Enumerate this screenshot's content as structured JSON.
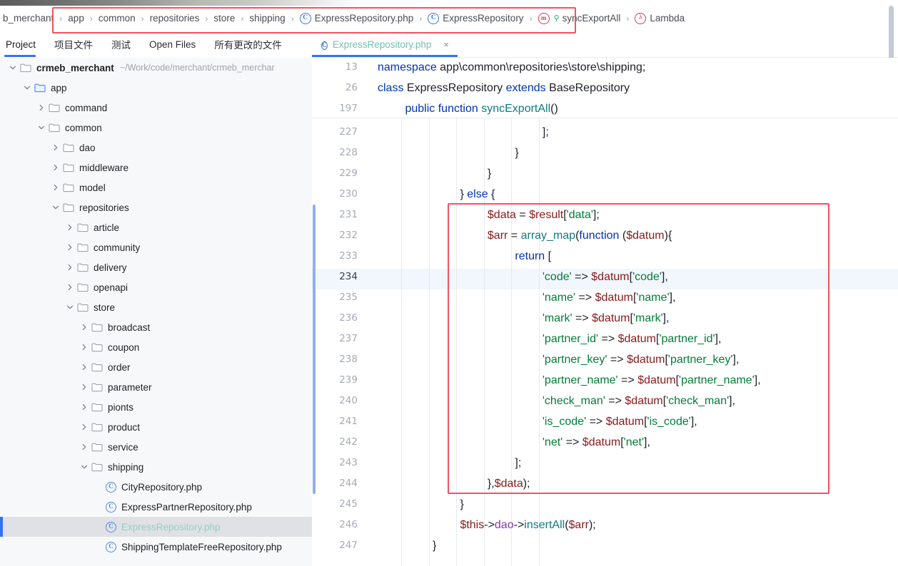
{
  "breadcrumb": {
    "items": [
      {
        "label": "b_merchant",
        "icon": null
      },
      {
        "label": "app",
        "icon": null
      },
      {
        "label": "common",
        "icon": null
      },
      {
        "label": "repositories",
        "icon": null
      },
      {
        "label": "store",
        "icon": null
      },
      {
        "label": "shipping",
        "icon": null
      },
      {
        "label": "ExpressRepository.php",
        "icon": "class-c-icon"
      },
      {
        "label": "ExpressRepository",
        "icon": "class-c-icon"
      },
      {
        "label": "syncExportAll",
        "icon": "method-m-icon"
      },
      {
        "label": "Lambda",
        "icon": "lambda-icon"
      }
    ],
    "separator": "›"
  },
  "toolbar": {
    "items": [
      {
        "label": "Project",
        "active": true
      },
      {
        "label": "项目文件",
        "active": false
      },
      {
        "label": "测试",
        "active": false
      },
      {
        "label": "Open Files",
        "active": false
      },
      {
        "label": "所有更改的文件",
        "active": false
      }
    ]
  },
  "editor_tab": {
    "label": "ExpressRepository.php",
    "close": "×",
    "icon": "class-c-icon"
  },
  "tree": {
    "root_path": "~/Work/code/merchant/crmeb_merchar",
    "items": [
      {
        "label": "crmeb_merchant",
        "depth": 0,
        "type": "folder",
        "state": "open",
        "root": true,
        "path": "~/Work/code/merchant/crmeb_merchar"
      },
      {
        "label": "app",
        "depth": 1,
        "type": "folder-src",
        "state": "open"
      },
      {
        "label": "command",
        "depth": 2,
        "type": "folder",
        "state": "closed"
      },
      {
        "label": "common",
        "depth": 2,
        "type": "folder",
        "state": "open"
      },
      {
        "label": "dao",
        "depth": 3,
        "type": "folder",
        "state": "closed"
      },
      {
        "label": "middleware",
        "depth": 3,
        "type": "folder",
        "state": "closed"
      },
      {
        "label": "model",
        "depth": 3,
        "type": "folder",
        "state": "closed"
      },
      {
        "label": "repositories",
        "depth": 3,
        "type": "folder",
        "state": "open"
      },
      {
        "label": "article",
        "depth": 4,
        "type": "folder",
        "state": "closed"
      },
      {
        "label": "community",
        "depth": 4,
        "type": "folder",
        "state": "closed"
      },
      {
        "label": "delivery",
        "depth": 4,
        "type": "folder",
        "state": "closed"
      },
      {
        "label": "openapi",
        "depth": 4,
        "type": "folder",
        "state": "closed"
      },
      {
        "label": "store",
        "depth": 4,
        "type": "folder",
        "state": "open"
      },
      {
        "label": "broadcast",
        "depth": 5,
        "type": "folder",
        "state": "closed"
      },
      {
        "label": "coupon",
        "depth": 5,
        "type": "folder",
        "state": "closed"
      },
      {
        "label": "order",
        "depth": 5,
        "type": "folder",
        "state": "closed"
      },
      {
        "label": "parameter",
        "depth": 5,
        "type": "folder",
        "state": "closed"
      },
      {
        "label": "pionts",
        "depth": 5,
        "type": "folder",
        "state": "closed"
      },
      {
        "label": "product",
        "depth": 5,
        "type": "folder",
        "state": "closed"
      },
      {
        "label": "service",
        "depth": 5,
        "type": "folder",
        "state": "closed"
      },
      {
        "label": "shipping",
        "depth": 5,
        "type": "folder",
        "state": "open"
      },
      {
        "label": "CityRepository.php",
        "depth": 6,
        "type": "php-class"
      },
      {
        "label": "ExpressPartnerRepository.php",
        "depth": 6,
        "type": "php-class"
      },
      {
        "label": "ExpressRepository.php",
        "depth": 6,
        "type": "php-class",
        "selected": true
      },
      {
        "label": "ShippingTemplateFreeRepository.php",
        "depth": 6,
        "type": "php-class"
      }
    ]
  },
  "editor": {
    "sticky_lines": [
      {
        "num": "13",
        "indent": 0
      },
      {
        "num": "26",
        "indent": 0
      },
      {
        "num": "197",
        "indent": 1
      }
    ],
    "current_line": "234",
    "change_bar_range": [
      "231",
      "244"
    ],
    "lines": [
      {
        "num": "227",
        "indent": 6
      },
      {
        "num": "228",
        "indent": 5
      },
      {
        "num": "229",
        "indent": 4
      },
      {
        "num": "230",
        "indent": 3
      },
      {
        "num": "231",
        "indent": 4
      },
      {
        "num": "232",
        "indent": 4
      },
      {
        "num": "233",
        "indent": 5
      },
      {
        "num": "234",
        "indent": 6
      },
      {
        "num": "235",
        "indent": 6
      },
      {
        "num": "236",
        "indent": 6
      },
      {
        "num": "237",
        "indent": 6
      },
      {
        "num": "238",
        "indent": 6
      },
      {
        "num": "239",
        "indent": 6
      },
      {
        "num": "240",
        "indent": 6
      },
      {
        "num": "241",
        "indent": 6
      },
      {
        "num": "242",
        "indent": 6
      },
      {
        "num": "243",
        "indent": 5
      },
      {
        "num": "244",
        "indent": 4
      },
      {
        "num": "245",
        "indent": 3
      },
      {
        "num": "246",
        "indent": 3
      },
      {
        "num": "247",
        "indent": 2
      }
    ],
    "code_text": {
      "l13": "namespace app\\common\\repositories\\store\\shipping;",
      "l26": "class ExpressRepository extends BaseRepository",
      "l197": "public function syncExportAll()",
      "l227": "];",
      "l228": "}",
      "l229": "}",
      "l230": "} else {",
      "l231": "$data = $result['data'];",
      "l232": "$arr = array_map(function ($datum){",
      "l233": "return [",
      "l234": "'code' => $datum['code'],",
      "l235": "'name' => $datum['name'],",
      "l236": "'mark' => $datum['mark'],",
      "l237": "'partner_id' => $datum['partner_id'],",
      "l238": "'partner_key' => $datum['partner_key'],",
      "l239": "'partner_name' => $datum['partner_name'],",
      "l240": "'check_man' => $datum['check_man'],",
      "l241": "'is_code' => $datum['is_code'],",
      "l242": "'net' => $datum['net'],",
      "l243": "];",
      "l244": "},$data);",
      "l245": "}",
      "l246": "$this->dao->insertAll($arr);",
      "l247": "}"
    }
  },
  "colors": {
    "accent_blue": "#3574f0",
    "highlight_red": "#f4515f",
    "change_bar_blue": "#91aef0",
    "keyword": "#0033b3",
    "string": "#027d36",
    "variable": "#871a1a",
    "function": "#0f7a80",
    "selected_tab_text": "#6fc2ad",
    "tree_bg": "#f7f8fa",
    "selection_bg": "#dfe1e5"
  }
}
